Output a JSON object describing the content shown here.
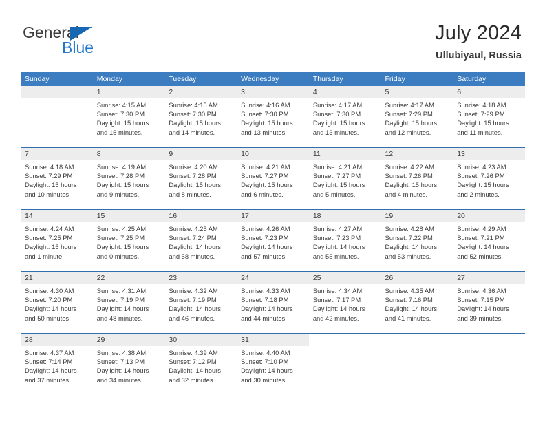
{
  "brand": {
    "name_part1": "General",
    "name_part2": "Blue",
    "triangle_color": "#1668b3",
    "blue_color": "#2277cc"
  },
  "header": {
    "title": "July 2024",
    "subtitle": "Ullubiyaul, Russia"
  },
  "theme": {
    "header_row_bg": "#3b7dc0",
    "row_divider": "#2f6fae",
    "day_number_band": "#ededed",
    "text": "#3a3a3a"
  },
  "weekday_headers": [
    "Sunday",
    "Monday",
    "Tuesday",
    "Wednesday",
    "Thursday",
    "Friday",
    "Saturday"
  ],
  "weeks": [
    [
      {
        "day": "",
        "sunrise": "",
        "sunset": "",
        "daylight_line1": "",
        "daylight_line2": ""
      },
      {
        "day": "1",
        "sunrise": "Sunrise: 4:15 AM",
        "sunset": "Sunset: 7:30 PM",
        "daylight_line1": "Daylight: 15 hours",
        "daylight_line2": "and 15 minutes."
      },
      {
        "day": "2",
        "sunrise": "Sunrise: 4:15 AM",
        "sunset": "Sunset: 7:30 PM",
        "daylight_line1": "Daylight: 15 hours",
        "daylight_line2": "and 14 minutes."
      },
      {
        "day": "3",
        "sunrise": "Sunrise: 4:16 AM",
        "sunset": "Sunset: 7:30 PM",
        "daylight_line1": "Daylight: 15 hours",
        "daylight_line2": "and 13 minutes."
      },
      {
        "day": "4",
        "sunrise": "Sunrise: 4:17 AM",
        "sunset": "Sunset: 7:30 PM",
        "daylight_line1": "Daylight: 15 hours",
        "daylight_line2": "and 13 minutes."
      },
      {
        "day": "5",
        "sunrise": "Sunrise: 4:17 AM",
        "sunset": "Sunset: 7:29 PM",
        "daylight_line1": "Daylight: 15 hours",
        "daylight_line2": "and 12 minutes."
      },
      {
        "day": "6",
        "sunrise": "Sunrise: 4:18 AM",
        "sunset": "Sunset: 7:29 PM",
        "daylight_line1": "Daylight: 15 hours",
        "daylight_line2": "and 11 minutes."
      }
    ],
    [
      {
        "day": "7",
        "sunrise": "Sunrise: 4:18 AM",
        "sunset": "Sunset: 7:29 PM",
        "daylight_line1": "Daylight: 15 hours",
        "daylight_line2": "and 10 minutes."
      },
      {
        "day": "8",
        "sunrise": "Sunrise: 4:19 AM",
        "sunset": "Sunset: 7:28 PM",
        "daylight_line1": "Daylight: 15 hours",
        "daylight_line2": "and 9 minutes."
      },
      {
        "day": "9",
        "sunrise": "Sunrise: 4:20 AM",
        "sunset": "Sunset: 7:28 PM",
        "daylight_line1": "Daylight: 15 hours",
        "daylight_line2": "and 8 minutes."
      },
      {
        "day": "10",
        "sunrise": "Sunrise: 4:21 AM",
        "sunset": "Sunset: 7:27 PM",
        "daylight_line1": "Daylight: 15 hours",
        "daylight_line2": "and 6 minutes."
      },
      {
        "day": "11",
        "sunrise": "Sunrise: 4:21 AM",
        "sunset": "Sunset: 7:27 PM",
        "daylight_line1": "Daylight: 15 hours",
        "daylight_line2": "and 5 minutes."
      },
      {
        "day": "12",
        "sunrise": "Sunrise: 4:22 AM",
        "sunset": "Sunset: 7:26 PM",
        "daylight_line1": "Daylight: 15 hours",
        "daylight_line2": "and 4 minutes."
      },
      {
        "day": "13",
        "sunrise": "Sunrise: 4:23 AM",
        "sunset": "Sunset: 7:26 PM",
        "daylight_line1": "Daylight: 15 hours",
        "daylight_line2": "and 2 minutes."
      }
    ],
    [
      {
        "day": "14",
        "sunrise": "Sunrise: 4:24 AM",
        "sunset": "Sunset: 7:25 PM",
        "daylight_line1": "Daylight: 15 hours",
        "daylight_line2": "and 1 minute."
      },
      {
        "day": "15",
        "sunrise": "Sunrise: 4:25 AM",
        "sunset": "Sunset: 7:25 PM",
        "daylight_line1": "Daylight: 15 hours",
        "daylight_line2": "and 0 minutes."
      },
      {
        "day": "16",
        "sunrise": "Sunrise: 4:25 AM",
        "sunset": "Sunset: 7:24 PM",
        "daylight_line1": "Daylight: 14 hours",
        "daylight_line2": "and 58 minutes."
      },
      {
        "day": "17",
        "sunrise": "Sunrise: 4:26 AM",
        "sunset": "Sunset: 7:23 PM",
        "daylight_line1": "Daylight: 14 hours",
        "daylight_line2": "and 57 minutes."
      },
      {
        "day": "18",
        "sunrise": "Sunrise: 4:27 AM",
        "sunset": "Sunset: 7:23 PM",
        "daylight_line1": "Daylight: 14 hours",
        "daylight_line2": "and 55 minutes."
      },
      {
        "day": "19",
        "sunrise": "Sunrise: 4:28 AM",
        "sunset": "Sunset: 7:22 PM",
        "daylight_line1": "Daylight: 14 hours",
        "daylight_line2": "and 53 minutes."
      },
      {
        "day": "20",
        "sunrise": "Sunrise: 4:29 AM",
        "sunset": "Sunset: 7:21 PM",
        "daylight_line1": "Daylight: 14 hours",
        "daylight_line2": "and 52 minutes."
      }
    ],
    [
      {
        "day": "21",
        "sunrise": "Sunrise: 4:30 AM",
        "sunset": "Sunset: 7:20 PM",
        "daylight_line1": "Daylight: 14 hours",
        "daylight_line2": "and 50 minutes."
      },
      {
        "day": "22",
        "sunrise": "Sunrise: 4:31 AM",
        "sunset": "Sunset: 7:19 PM",
        "daylight_line1": "Daylight: 14 hours",
        "daylight_line2": "and 48 minutes."
      },
      {
        "day": "23",
        "sunrise": "Sunrise: 4:32 AM",
        "sunset": "Sunset: 7:19 PM",
        "daylight_line1": "Daylight: 14 hours",
        "daylight_line2": "and 46 minutes."
      },
      {
        "day": "24",
        "sunrise": "Sunrise: 4:33 AM",
        "sunset": "Sunset: 7:18 PM",
        "daylight_line1": "Daylight: 14 hours",
        "daylight_line2": "and 44 minutes."
      },
      {
        "day": "25",
        "sunrise": "Sunrise: 4:34 AM",
        "sunset": "Sunset: 7:17 PM",
        "daylight_line1": "Daylight: 14 hours",
        "daylight_line2": "and 42 minutes."
      },
      {
        "day": "26",
        "sunrise": "Sunrise: 4:35 AM",
        "sunset": "Sunset: 7:16 PM",
        "daylight_line1": "Daylight: 14 hours",
        "daylight_line2": "and 41 minutes."
      },
      {
        "day": "27",
        "sunrise": "Sunrise: 4:36 AM",
        "sunset": "Sunset: 7:15 PM",
        "daylight_line1": "Daylight: 14 hours",
        "daylight_line2": "and 39 minutes."
      }
    ],
    [
      {
        "day": "28",
        "sunrise": "Sunrise: 4:37 AM",
        "sunset": "Sunset: 7:14 PM",
        "daylight_line1": "Daylight: 14 hours",
        "daylight_line2": "and 37 minutes."
      },
      {
        "day": "29",
        "sunrise": "Sunrise: 4:38 AM",
        "sunset": "Sunset: 7:13 PM",
        "daylight_line1": "Daylight: 14 hours",
        "daylight_line2": "and 34 minutes."
      },
      {
        "day": "30",
        "sunrise": "Sunrise: 4:39 AM",
        "sunset": "Sunset: 7:12 PM",
        "daylight_line1": "Daylight: 14 hours",
        "daylight_line2": "and 32 minutes."
      },
      {
        "day": "31",
        "sunrise": "Sunrise: 4:40 AM",
        "sunset": "Sunset: 7:10 PM",
        "daylight_line1": "Daylight: 14 hours",
        "daylight_line2": "and 30 minutes."
      },
      {
        "day": "",
        "sunrise": "",
        "sunset": "",
        "daylight_line1": "",
        "daylight_line2": ""
      },
      {
        "day": "",
        "sunrise": "",
        "sunset": "",
        "daylight_line1": "",
        "daylight_line2": ""
      },
      {
        "day": "",
        "sunrise": "",
        "sunset": "",
        "daylight_line1": "",
        "daylight_line2": ""
      }
    ]
  ]
}
